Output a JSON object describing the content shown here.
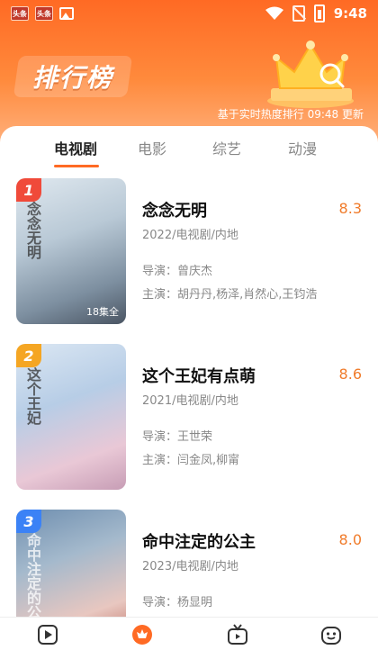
{
  "status_bar": {
    "time": "9:48",
    "left_icons": [
      {
        "icon": "toutiao-notification-icon",
        "text": "头条"
      },
      {
        "icon": "toutiao-notification-icon",
        "text": "头条"
      },
      {
        "icon": "image-notification-icon"
      }
    ],
    "right_icons": [
      "wifi-icon",
      "no-sim-icon",
      "battery-charging-icon"
    ]
  },
  "banner": {
    "title": "排行榜",
    "update_text": "基于实时热度排行 09:48 更新",
    "accent_color": "#ff6a24"
  },
  "tabs": [
    {
      "label": "电视剧",
      "active": true
    },
    {
      "label": "电影",
      "active": false
    },
    {
      "label": "综艺",
      "active": false
    },
    {
      "label": "动漫",
      "active": false
    }
  ],
  "rankings": [
    {
      "rank": "1",
      "badge_color": "#f04a3a",
      "poster_text": "念念无明",
      "poster_caption": "18集全",
      "title": "念念无明",
      "score": "8.3",
      "meta": "2022/电视剧/内地",
      "director": "导演：曾庆杰",
      "cast": "主演：胡丹丹,杨泽,肖然心,王钧浩"
    },
    {
      "rank": "2",
      "badge_color": "#f5a623",
      "poster_text": "这个王妃",
      "poster_caption": "",
      "title": "这个王妃有点萌",
      "score": "8.6",
      "meta": "2021/电视剧/内地",
      "director": "导演：王世荣",
      "cast": "主演：闫金凤,柳甯"
    },
    {
      "rank": "3",
      "badge_color": "#3b82f6",
      "poster_text": "命中注定的公主",
      "poster_caption": "",
      "title": "命中注定的公主",
      "score": "8.0",
      "meta": "2023/电视剧/内地",
      "director": "导演：杨显明",
      "cast": ""
    }
  ],
  "bottom_nav": [
    {
      "icon": "play-icon",
      "active": false
    },
    {
      "icon": "ranking-icon",
      "active": true
    },
    {
      "icon": "tv-icon",
      "active": false
    },
    {
      "icon": "profile-face-icon",
      "active": false
    }
  ]
}
